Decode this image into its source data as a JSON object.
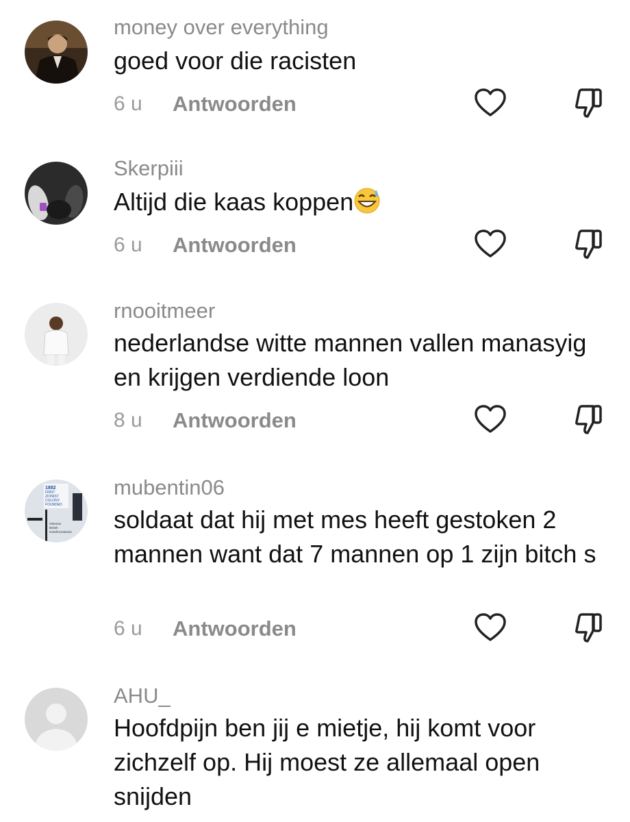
{
  "comments": [
    {
      "username": "money over everything",
      "text": "goed voor die racisten",
      "time": "6 u",
      "reply_label": "Antwoorden",
      "avatar_icon": "person-suit-photo"
    },
    {
      "username": "Skerpiii",
      "text": "Altijd die kaas koppen",
      "emoji": "grinning-face-with-sweat-emoji",
      "time": "6 u",
      "reply_label": "Antwoorden",
      "avatar_icon": "dark-shoes-photo"
    },
    {
      "username": "rnooitmeer",
      "text": "nederlandse witte mannen vallen manasyig en krijgen verdiende loon",
      "time": "8 u",
      "reply_label": "Antwoorden",
      "avatar_icon": "man-white-sweater-photo"
    },
    {
      "username": "mubentin06",
      "text": "soldaat dat hij met mes heeft gestoken 2 mannen want dat 7 mannen op 1 zijn bitch s",
      "time": "6 u",
      "reply_label": "Antwoorden",
      "avatar_icon": "map-timeline-image",
      "avatar_text": [
        "1882",
        "FIRST",
        "ZIONIST",
        "COLONY",
        "FOUNDED",
        "Ottoman",
        "British",
        "Israeli/Jordanian"
      ]
    },
    {
      "username": "AHU_",
      "text": "Hoofdpijn ben jij e mietje, hij komt voor zichzelf op. Hij moest ze allemaal open snijden",
      "avatar_icon": "default-avatar-icon"
    }
  ],
  "icons": {
    "like": "heart-outline-icon",
    "dislike": "thumbs-down-outline-icon"
  },
  "colors": {
    "username": "#8a8a8a",
    "text": "#111111",
    "meta": "#9a9a9a",
    "icon": "#222222"
  }
}
